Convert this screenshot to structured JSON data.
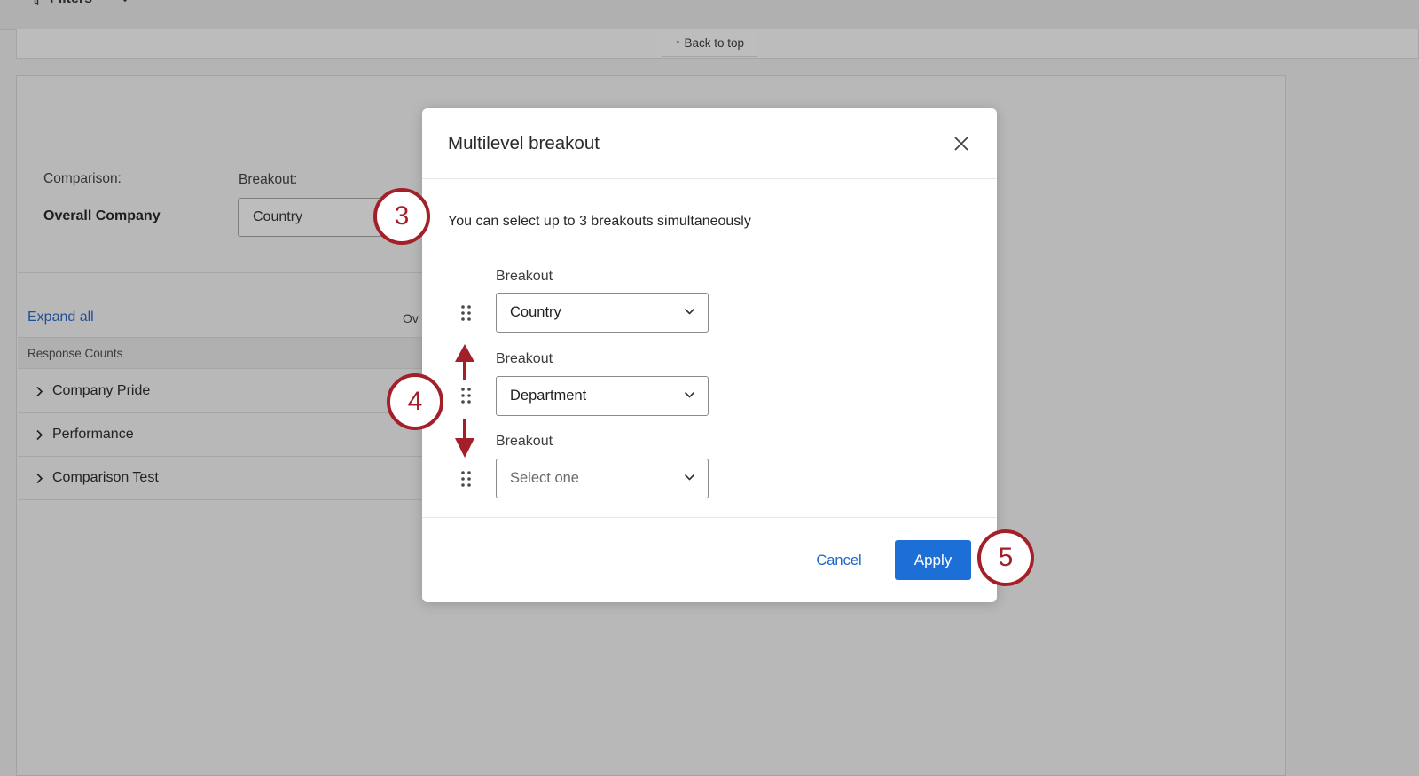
{
  "header": {
    "filters_label": "Filters"
  },
  "back_to_top": "↑ Back to top",
  "report": {
    "comparison_label": "Comparison:",
    "comparison_value": "Overall Company",
    "breakout_label": "Breakout:",
    "breakout_value": "Country",
    "expand_all": "Expand all",
    "partial_column": "Ov",
    "section_header": "Response Counts",
    "rows": [
      "Company Pride",
      "Performance",
      "Comparison Test"
    ]
  },
  "modal": {
    "title": "Multilevel breakout",
    "description": "You can select up to 3 breakouts simultaneously",
    "breakouts": [
      {
        "label": "Breakout",
        "value": "Country",
        "placeholder": false
      },
      {
        "label": "Breakout",
        "value": "Department",
        "placeholder": false
      },
      {
        "label": "Breakout",
        "value": "Select one",
        "placeholder": true
      }
    ],
    "cancel_label": "Cancel",
    "apply_label": "Apply"
  },
  "callouts": [
    "3",
    "4",
    "5"
  ],
  "colors": {
    "accent": "#1b6fd6",
    "callout": "#a3202a",
    "link": "#1f66c9"
  }
}
